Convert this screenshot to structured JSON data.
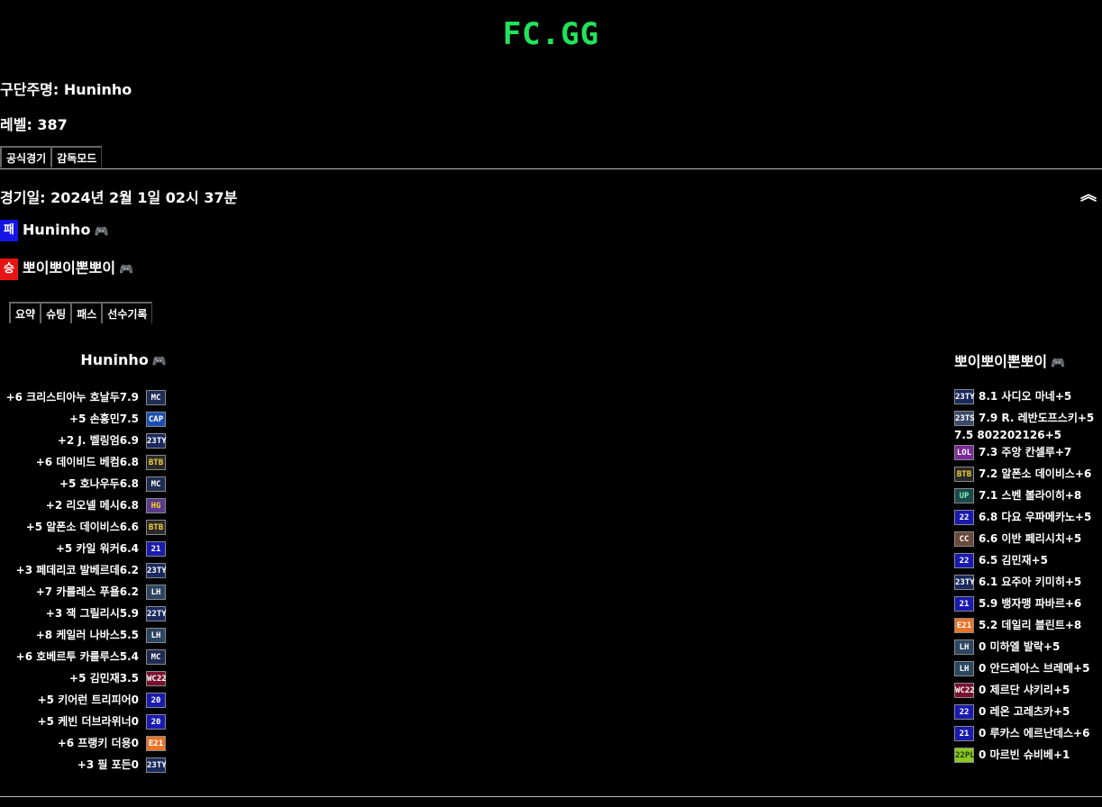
{
  "logo": "FC.GG",
  "info": {
    "club_label": "구단주명: Huninho",
    "level_label": "레벨: 387"
  },
  "mode_tabs": [
    "공식경기",
    "감독모드"
  ],
  "match": {
    "date_label": "경기일: 2024년 2월 1일 02시 37분",
    "collapse_icon": "double-chevron-up-icon",
    "loser": {
      "badge": "패",
      "name": "Huninho",
      "color": "#1414e6"
    },
    "winner": {
      "badge": "승",
      "name": "뽀이뽀이뽄뽀이",
      "color": "#e61414"
    },
    "gamepad_icon": "🎮"
  },
  "detail_tabs": [
    "요약",
    "슈팅",
    "패스",
    "선수기록"
  ],
  "home": {
    "name": "Huninho",
    "players": [
      {
        "text": "+6 크리스티아누 호날두7.9",
        "season": "MC",
        "bg": "#1f2d54",
        "fg": "#ffffff"
      },
      {
        "text": "+5 손흥민7.5",
        "season": "CAP",
        "bg": "#1b4fb3",
        "fg": "#ffffff"
      },
      {
        "text": "+2 J. 벨링엄6.9",
        "season": "23TY",
        "bg": "#1a2a5e",
        "fg": "#ffffff"
      },
      {
        "text": "+6 데이비드 베컴6.8",
        "season": "BTB",
        "bg": "#2a2a2a",
        "fg": "#f5d033"
      },
      {
        "text": "+5 호나우두6.8",
        "season": "MC",
        "bg": "#1f2d54",
        "fg": "#ffffff"
      },
      {
        "text": "+2 리오넬 메시6.8",
        "season": "HG",
        "bg": "#5b3b8a",
        "fg": "#f5d033"
      },
      {
        "text": "+5 알폰소 데이비스6.6",
        "season": "BTB",
        "bg": "#2a2a2a",
        "fg": "#f5d033"
      },
      {
        "text": "+5 카일 워커6.4",
        "season": "21",
        "bg": "#1a1ab0",
        "fg": "#ffffff"
      },
      {
        "text": "+3 페데리코 발베르데6.2",
        "season": "23TY",
        "bg": "#1a2a5e",
        "fg": "#ffffff"
      },
      {
        "text": "+7 카를레스 푸욜6.2",
        "season": "LH",
        "bg": "#2d4660",
        "fg": "#ffffff"
      },
      {
        "text": "+3 잭 그릴리시5.9",
        "season": "22TY",
        "bg": "#1a2a5e",
        "fg": "#ffffff"
      },
      {
        "text": "+8 케일러 나바스5.5",
        "season": "LH",
        "bg": "#2d4660",
        "fg": "#ffffff"
      },
      {
        "text": "+6 호베르투 카를루스5.4",
        "season": "MC",
        "bg": "#1f2d54",
        "fg": "#ffffff"
      },
      {
        "text": "+5 김민재3.5",
        "season": "WC22",
        "bg": "#7a1030",
        "fg": "#ffffff"
      },
      {
        "text": "+5 키어런 트리피어0",
        "season": "20",
        "bg": "#1a1ab0",
        "fg": "#ffffff"
      },
      {
        "text": "+5 케빈 더브라위너0",
        "season": "20",
        "bg": "#1a1ab0",
        "fg": "#ffffff"
      },
      {
        "text": "+6 프랭키 더용0",
        "season": "E21",
        "bg": "#e8732a",
        "fg": "#ffffff"
      },
      {
        "text": "+3 필 포든0",
        "season": "23TY",
        "bg": "#1a2a5e",
        "fg": "#ffffff"
      }
    ]
  },
  "away": {
    "name": "뽀이뽀이뽄뽀이",
    "players": [
      {
        "text": "8.1 사디오 마네+5",
        "season": "23TY",
        "bg": "#1a2a5e",
        "fg": "#ffffff"
      },
      {
        "text": "7.9 R. 레반도프스키+5",
        "season": "23TS",
        "bg": "#3a4a6a",
        "fg": "#ffffff"
      },
      {
        "text": "7.5 802202126+5",
        "season": "",
        "bg": "",
        "fg": ""
      },
      {
        "text": "7.3 주앙 칸셀루+7",
        "season": "LOL",
        "bg": "#7a2a9a",
        "fg": "#ffffff"
      },
      {
        "text": "7.2 알폰소 데이비스+6",
        "season": "BTB",
        "bg": "#2a2a2a",
        "fg": "#f5d033"
      },
      {
        "text": "7.1 스벤 볼라이히+8",
        "season": "UP",
        "bg": "#1a4a4a",
        "fg": "#7ff0c0"
      },
      {
        "text": "6.8 다요 우파메카노+5",
        "season": "22",
        "bg": "#1a1ab0",
        "fg": "#ffffff"
      },
      {
        "text": "6.6 이반 페리시치+5",
        "season": "CC",
        "bg": "#6a4a3a",
        "fg": "#ffffff"
      },
      {
        "text": "6.5 김민재+5",
        "season": "22",
        "bg": "#1a1ab0",
        "fg": "#ffffff"
      },
      {
        "text": "6.1 요주아 키미히+5",
        "season": "23TY",
        "bg": "#1a2a5e",
        "fg": "#ffffff"
      },
      {
        "text": "5.9 뱅자맹 파바르+6",
        "season": "21",
        "bg": "#1a1ab0",
        "fg": "#ffffff"
      },
      {
        "text": "5.2 데일리 블린트+8",
        "season": "E21",
        "bg": "#e8732a",
        "fg": "#ffffff"
      },
      {
        "text": "0 미하엘 발락+5",
        "season": "LH",
        "bg": "#2d4660",
        "fg": "#ffffff"
      },
      {
        "text": "0 안드레아스 브레메+5",
        "season": "LH",
        "bg": "#2d4660",
        "fg": "#ffffff"
      },
      {
        "text": "0 제르단 샤키리+5",
        "season": "WC22",
        "bg": "#7a1030",
        "fg": "#ffffff"
      },
      {
        "text": "0 레온 고레츠카+5",
        "season": "22",
        "bg": "#1a1ab0",
        "fg": "#ffffff"
      },
      {
        "text": "0 루카스 에르난데스+6",
        "season": "21",
        "bg": "#1a1ab0",
        "fg": "#ffffff"
      },
      {
        "text": "0 마르빈 슈비베+1",
        "season": "22PL",
        "bg": "#8ac820",
        "fg": "#1a3a00"
      }
    ]
  }
}
